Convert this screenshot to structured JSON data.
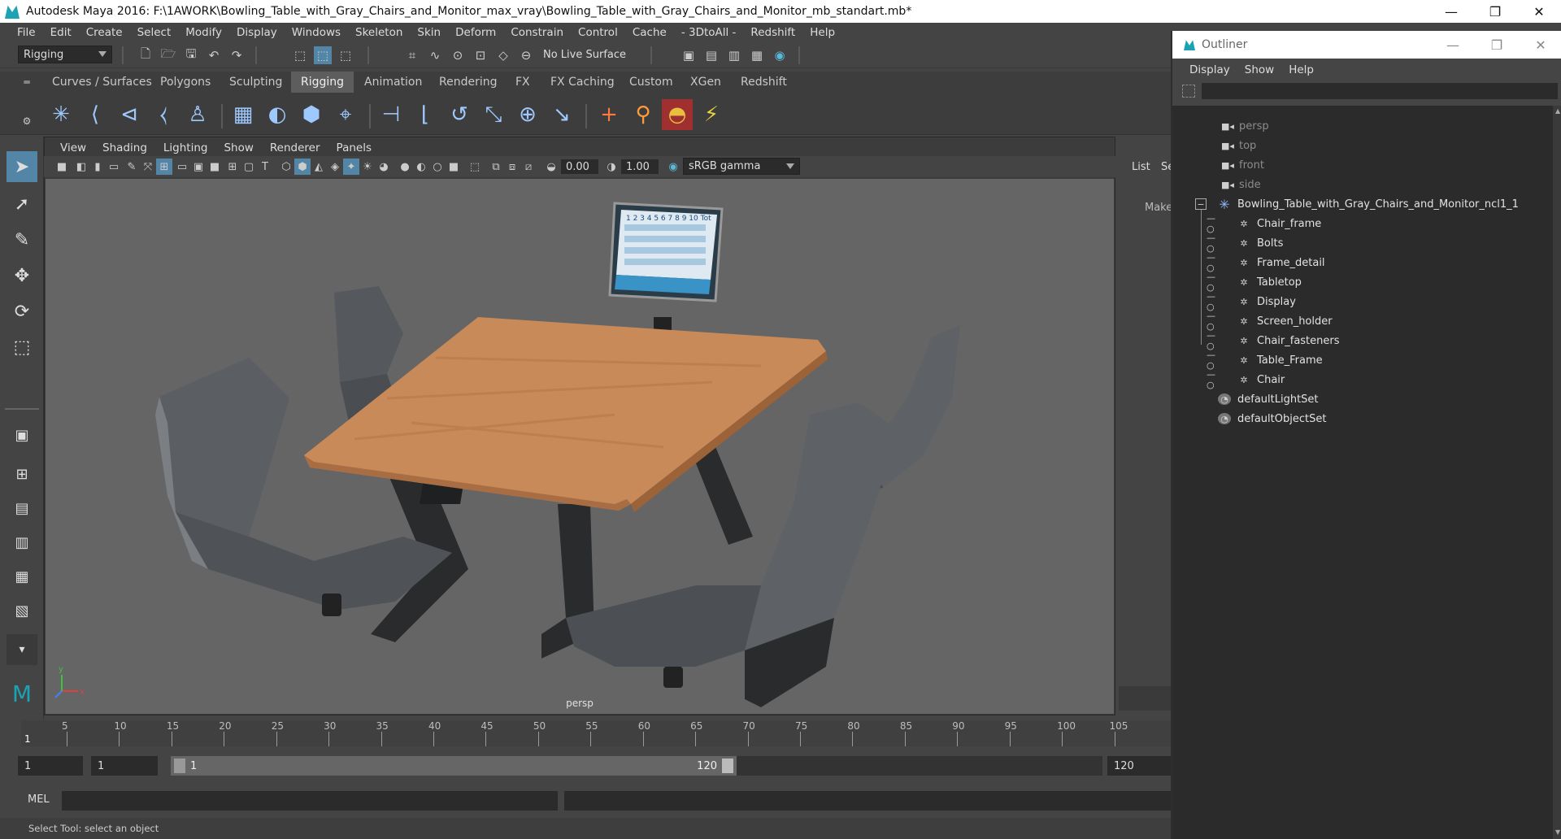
{
  "window": {
    "title": "Autodesk Maya 2016: F:\\1AWORK\\Bowling_Table_with_Gray_Chairs_and_Monitor_max_vray\\Bowling_Table_with_Gray_Chairs_and_Monitor_mb_standart.mb*",
    "minimize": "—",
    "restore": "❐",
    "close": "✕"
  },
  "menubar": [
    "File",
    "Edit",
    "Create",
    "Select",
    "Modify",
    "Display",
    "Windows",
    "Skeleton",
    "Skin",
    "Deform",
    "Constrain",
    "Control",
    "Cache",
    "- 3DtoAll -",
    "Redshift",
    "Help"
  ],
  "statusline": {
    "mode": "Rigging",
    "live_surface": "No Live Surface"
  },
  "shelf_tabs": [
    "Curves / Surfaces",
    "Polygons",
    "Sculpting",
    "Rigging",
    "Animation",
    "Rendering",
    "FX",
    "FX Caching",
    "Custom",
    "XGen",
    "Redshift"
  ],
  "shelf_active": "Rigging",
  "viewport": {
    "menu": [
      "View",
      "Shading",
      "Lighting",
      "Show",
      "Renderer",
      "Panels"
    ],
    "exposure": "0.00",
    "gamma": "1.00",
    "color_space": "sRGB gamma",
    "camera_label": "persp"
  },
  "rightstrip": {
    "list": "List",
    "se": "Se",
    "make": "Make"
  },
  "timeline": {
    "ticks": [
      "5",
      "10",
      "15",
      "20",
      "25",
      "30",
      "35",
      "40",
      "45",
      "50",
      "55",
      "60",
      "65",
      "70",
      "75",
      "80",
      "85",
      "90",
      "95",
      "100",
      "105"
    ],
    "current_frame": "1"
  },
  "range": {
    "start": "1",
    "playback_start": "1",
    "range_start": "1",
    "range_end": "120",
    "end": "120"
  },
  "cmdline": {
    "label": "MEL"
  },
  "helpline": "Select Tool: select an object",
  "outliner": {
    "title": "Outliner",
    "menu": [
      "Display",
      "Show",
      "Help"
    ],
    "cameras": [
      "persp",
      "top",
      "front",
      "side"
    ],
    "root": "Bowling_Table_with_Gray_Chairs_and_Monitor_ncl1_1",
    "children": [
      "Chair_frame",
      "Bolts",
      "Frame_detail",
      "Tabletop",
      "Display",
      "Screen_holder",
      "Chair_fasteners",
      "Table_Frame",
      "Chair"
    ],
    "sets": [
      "defaultLightSet",
      "defaultObjectSet"
    ]
  },
  "monitor_screen": {
    "header": "1 2 3 4 5 6 7 8 9 10 Tot"
  },
  "colors": {
    "accent": "#5285a6",
    "viewport_bg": "#656565",
    "tabletop": "#c98a5a",
    "chair": "#5a5c60"
  }
}
